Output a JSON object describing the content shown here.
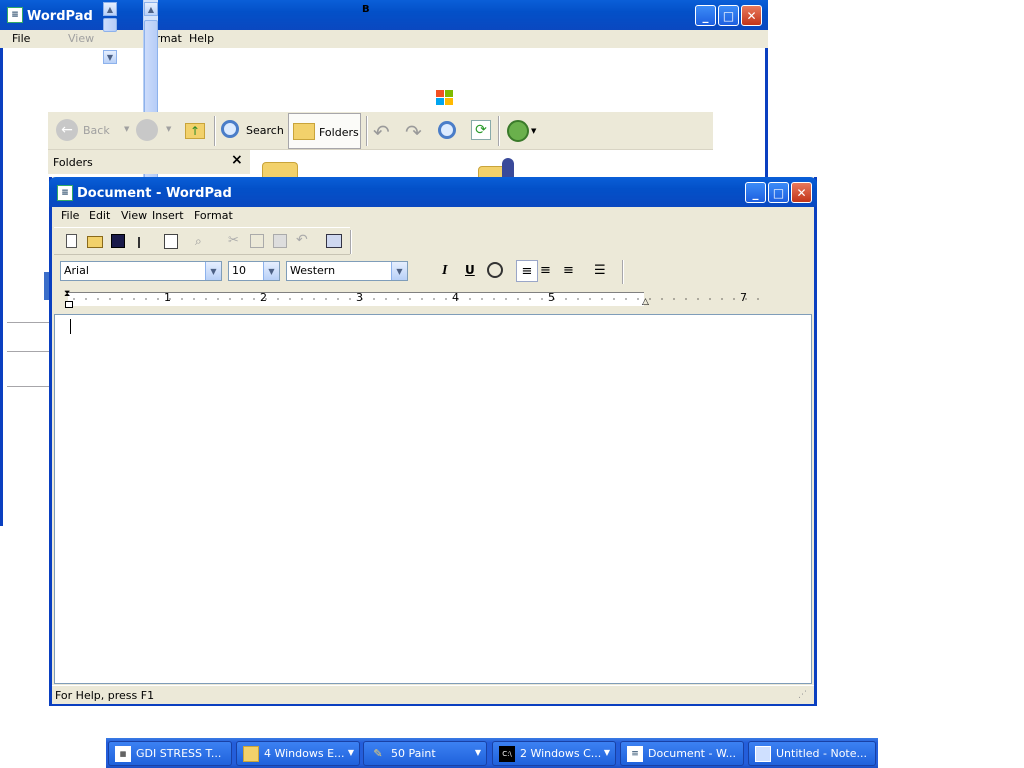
{
  "bg_window": {
    "title": "WordPad",
    "menu": [
      "File",
      "View",
      "Format",
      "Help"
    ],
    "stray_char": "B"
  },
  "explorer": {
    "toolbar": {
      "back": "Back",
      "search": "Search",
      "folders": "Folders"
    },
    "folders_pane_title": "Folders",
    "close_glyph": "×"
  },
  "wordpad": {
    "title": "Document - WordPad",
    "menu": [
      "File",
      "Edit",
      "View",
      "Insert",
      "Format"
    ],
    "font": "Arial",
    "size": "10",
    "script": "Western",
    "ruler_numbers": [
      "1",
      "2",
      "3",
      "4",
      "5",
      "7"
    ],
    "status": "For Help, press F1"
  },
  "taskbar": {
    "items": [
      {
        "label": "GDI STRESS T...",
        "icon": "app-icon"
      },
      {
        "label": "4 Windows E...",
        "icon": "folder-icon"
      },
      {
        "label": "50 Paint",
        "icon": "paint-icon"
      },
      {
        "label": "2 Windows C...",
        "icon": "console-icon"
      },
      {
        "label": "Document - W...",
        "icon": "wordpad-icon"
      },
      {
        "label": "Untitled - Note...",
        "icon": "notepad-icon"
      }
    ]
  },
  "colors": {
    "xp_blue": "#0a5fd8",
    "face": "#ece9d8",
    "taskbar": "#245edb"
  }
}
